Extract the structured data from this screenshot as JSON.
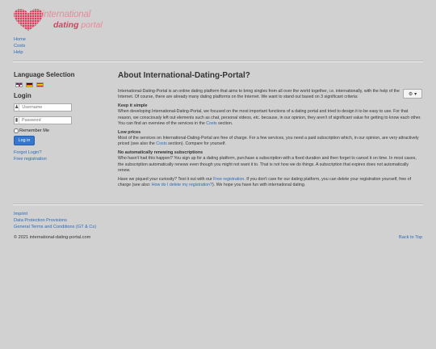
{
  "logo": {
    "line1": "international",
    "line2_bold": "dating",
    "line2_rest": " portal"
  },
  "topnav": {
    "items": [
      "Home",
      "Costs",
      "Help"
    ]
  },
  "sidebar": {
    "language_heading": "Language Selection",
    "login_heading": "Login",
    "username_placeholder": "Username",
    "password_placeholder": "Password",
    "remember_label": "Remember Me",
    "login_button": "Log in",
    "forgot_link": "Forgot Login?",
    "register_link": "Free registration"
  },
  "main": {
    "title": "About International-Dating-Portal?",
    "gear_label": "⚙ ▾",
    "intro": "International-Dating-Portal is an online dating platform that aims to bring singles from all over the world together, i.e. internationally, with the help of the Internet. Of course, there are already many dating platforms on the Internet. We want to stand out based on 3 significant criteria:",
    "s1_heading": "Keep it simple",
    "s1_text_a": "When developing International-Dating-Portal, we focused on the most important functions of a dating portal and tried to design it to be easy to use. For that reason, we consciously left out elements such as chat, personal videos, etc. because, in our opinion, they aren't of significant value for getting to know each other. You can find an overview of the services in the ",
    "s1_link": "Costs",
    "s1_text_b": " section.",
    "s2_heading": "Low prices",
    "s2_text_a": "Most of the services on International-Dating-Portal are free of charge. For a few services, you need a paid subscription which, in our opinion, are very attractively priced (see also the ",
    "s2_link": "Costs",
    "s2_text_b": " section). Compare for yourself.",
    "s3_heading": "No automatically renewing subscriptions",
    "s3_text": "Who hasn't had this happen? You sign up for a dating platform, purchase a subscription with a fixed duration and then forget to cancel it on time. In most cases, the subscription automatically renews even though you might not want it to. That is not how we do things. A subscription that expires does not automatically renew.",
    "closing_a": "Have we piqued your curiosity? Test it out with our ",
    "closing_link1": "Free registration",
    "closing_b": ". If you don't care for our dating platform, you can delete your registration yourself, free of charge (see also: ",
    "closing_link2": "How do I delete my registration?",
    "closing_c": "). We hope you have fun with international dating."
  },
  "footer": {
    "links": [
      "Imprint",
      "Data Protection Provisions",
      "General Terms and Conditions (GT & Cs)"
    ],
    "copyright": "© 2021 international-dating-portal.com",
    "back_to_top": "Back to Top"
  },
  "colors": {
    "background": "#d1d1d1",
    "link": "#2a6ab8",
    "brand_red": "#d84060",
    "button": "#3477cf"
  },
  "icons": {
    "user": "user-icon",
    "lock": "lock-icon",
    "gear": "gear-icon"
  }
}
